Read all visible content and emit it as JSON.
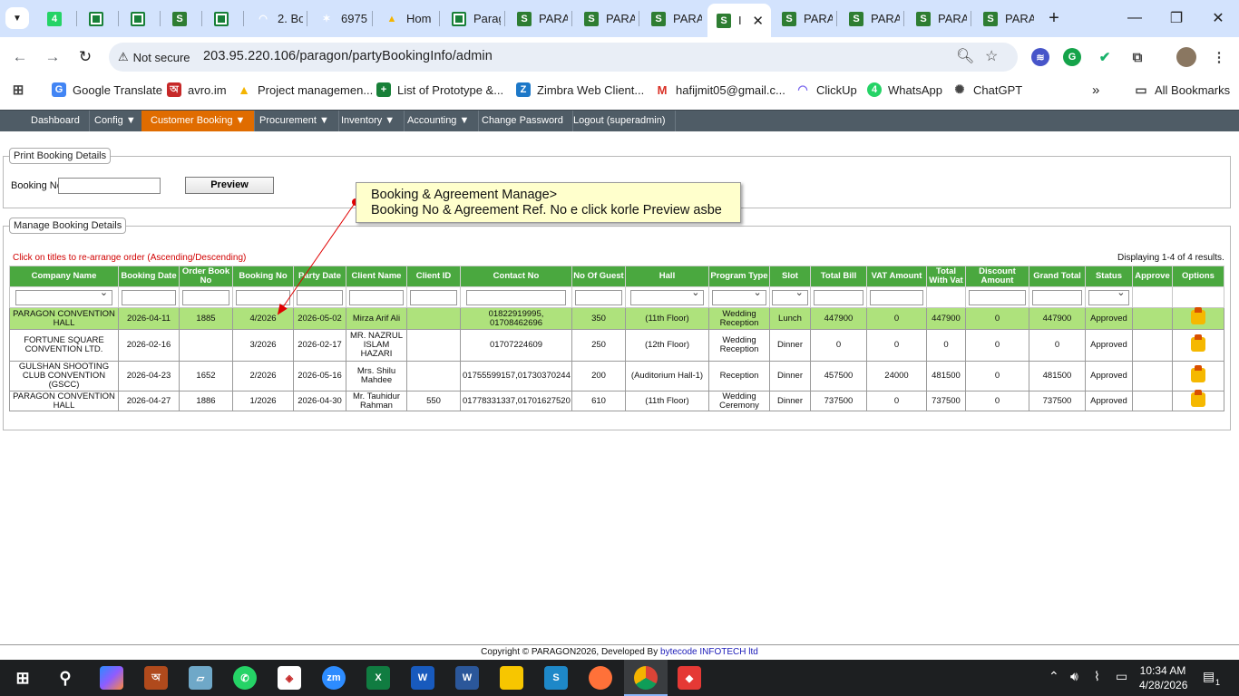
{
  "browser": {
    "tabs": [
      {
        "title": "",
        "icon": "whatsapp-icon",
        "badge": "4"
      },
      {
        "title": "",
        "icon": "sheets-icon"
      },
      {
        "title": "",
        "icon": "sheets-icon"
      },
      {
        "title": "",
        "icon": "para-icon"
      },
      {
        "title": "",
        "icon": "sheets-icon"
      },
      {
        "title": "2. Bo",
        "icon": "clickup-icon"
      },
      {
        "title": "6975",
        "icon": "misc-icon"
      },
      {
        "title": "Hom",
        "icon": "drive-icon"
      },
      {
        "title": "Parag",
        "icon": "sheets-icon"
      },
      {
        "title": "PARA",
        "icon": "para-icon"
      },
      {
        "title": "PARA",
        "icon": "para-icon"
      },
      {
        "title": "PARA",
        "icon": "para-icon"
      },
      {
        "title": "I",
        "icon": "para-icon",
        "active": true
      },
      {
        "title": "PARA",
        "icon": "para-icon"
      },
      {
        "title": "PARA",
        "icon": "para-icon"
      },
      {
        "title": "PARA",
        "icon": "para-icon"
      },
      {
        "title": "PARA",
        "icon": "para-icon"
      }
    ],
    "security_label": "Not secure",
    "url": "203.95.220.106/paragon/partyBookingInfo/admin",
    "bookmarks": [
      {
        "label": "Google Translate",
        "icon": "translate-icon"
      },
      {
        "label": "avro.im",
        "icon": "avro-icon"
      },
      {
        "label": "Project managemen...",
        "icon": "drive-icon"
      },
      {
        "label": "List of Prototype &...",
        "icon": "sheets-icon"
      },
      {
        "label": "Zimbra Web Client...",
        "icon": "zimbra-icon"
      },
      {
        "label": "hafijmit05@gmail.c...",
        "icon": "gmail-icon"
      },
      {
        "label": "ClickUp",
        "icon": "clickup-icon"
      },
      {
        "label": "WhatsApp",
        "icon": "whatsapp-icon",
        "badge": "4"
      },
      {
        "label": "ChatGPT",
        "icon": "chatgpt-icon"
      }
    ],
    "all_bookmarks": "All Bookmarks"
  },
  "menu": {
    "items": [
      "Dashboard",
      "Config ▼",
      "Customer Booking ▼",
      "Procurement ▼",
      "Inventory ▼",
      "Accounting ▼",
      "Change Password",
      "Logout (superadmin)"
    ],
    "active_index": 2
  },
  "print_box": {
    "legend": "Print Booking Details",
    "booking_label": "Booking No",
    "booking_value": "",
    "preview_button": "Preview"
  },
  "tooltip": {
    "line1": "Booking & Agreement Manage>",
    "line2": "Booking No & Agreement Ref. No e click korle Preview asbe"
  },
  "manage_box": {
    "legend": "Manage Booking Details",
    "hint": "Click on titles to re-arrange order (Ascending/Descending)",
    "results": "Displaying 1-4 of 4 results."
  },
  "table": {
    "columns": [
      "Company Name",
      "Booking Date",
      "Order Book No",
      "Booking No",
      "Party Date",
      "Client Name",
      "Client ID",
      "Contact No",
      "No Of Guest",
      "Hall",
      "Program Type",
      "Slot",
      "Total Bill",
      "VAT Amount",
      "Total With Vat",
      "Discount Amount",
      "Grand Total",
      "Status",
      "Approve",
      "Options"
    ],
    "rows": [
      [
        "PARAGON CONVENTION HALL",
        "2026-04-11",
        "1885",
        "4/2026",
        "2026-05-02",
        "Mirza Arif Ali",
        "",
        "01822919995, 01708462696",
        "350",
        "(11th Floor)",
        "Wedding Reception",
        "Lunch",
        "447900",
        "0",
        "447900",
        "0",
        "447900",
        "Approved",
        "",
        ""
      ],
      [
        "FORTUNE SQUARE CONVENTION LTD.",
        "2026-02-16",
        "",
        "3/2026",
        "2026-02-17",
        "MR. NAZRUL ISLAM HAZARI",
        "",
        "01707224609",
        "250",
        "(12th Floor)",
        "Wedding Reception",
        "Dinner",
        "0",
        "0",
        "0",
        "0",
        "0",
        "Approved",
        "",
        ""
      ],
      [
        "GULSHAN SHOOTING CLUB CONVENTION (GSCC)",
        "2026-04-23",
        "1652",
        "2/2026",
        "2026-05-16",
        "Mrs. Shilu Mahdee",
        "",
        "01755599157,01730370244",
        "200",
        "(Auditorium Hall-1)",
        "Reception",
        "Dinner",
        "457500",
        "24000",
        "481500",
        "0",
        "481500",
        "Approved",
        "",
        ""
      ],
      [
        "PARAGON CONVENTION HALL",
        "2026-04-27",
        "1886",
        "1/2026",
        "2026-04-30",
        "Mr. Tauhidur Rahman",
        "550",
        "01778331337,01701627520",
        "610",
        "(11th Floor)",
        "Wedding Ceremony",
        "Dinner",
        "737500",
        "0",
        "737500",
        "0",
        "737500",
        "Approved",
        "",
        ""
      ]
    ]
  },
  "footer": {
    "text": "Copyright © PARAGON2026, Developed By ",
    "link": "bytecode INFOTECH ltd"
  },
  "taskbar": {
    "time": "10:34 AM",
    "date": "4/28/2026",
    "notifications": "1"
  }
}
